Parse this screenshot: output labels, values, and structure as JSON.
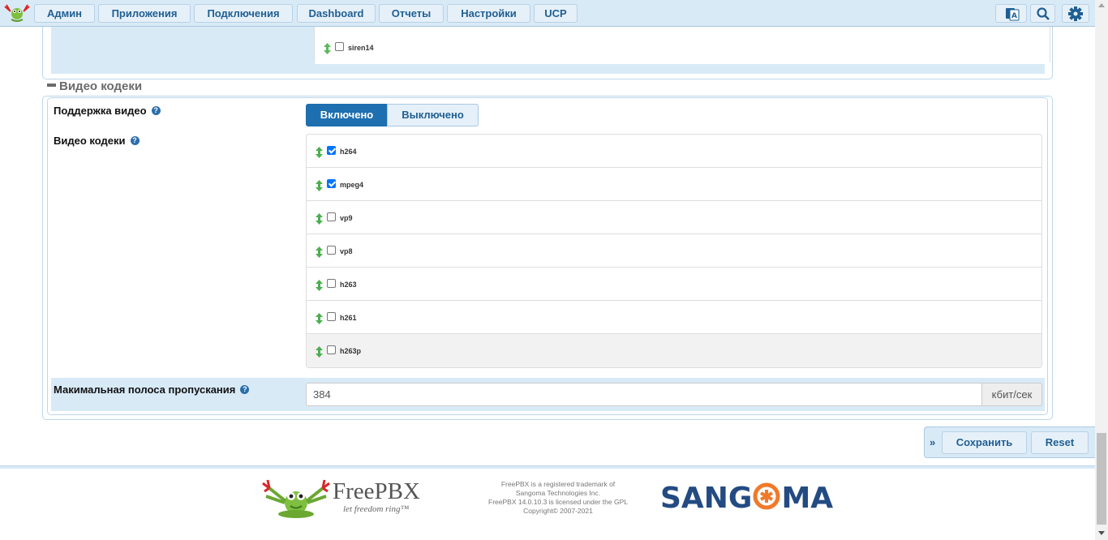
{
  "nav": {
    "items": [
      {
        "label": "Админ"
      },
      {
        "label": "Приложения"
      },
      {
        "label": "Подключения"
      },
      {
        "label": "Dashboard"
      },
      {
        "label": "Отчеты"
      },
      {
        "label": "Настройки"
      },
      {
        "label": "UCP"
      }
    ],
    "icons": [
      "language-icon",
      "search-icon",
      "gear-icon"
    ]
  },
  "prev_section": {
    "codec": {
      "name": "siren14",
      "checked": false
    }
  },
  "video_section": {
    "title": "Видео кодеки",
    "support_label": "Поддержка видео",
    "toggle": {
      "on_label": "Включено",
      "off_label": "Выключено",
      "selected": "Включено"
    },
    "codecs_label": "Видео кодеки",
    "codecs": [
      {
        "name": "h264",
        "checked": true
      },
      {
        "name": "mpeg4",
        "checked": true
      },
      {
        "name": "vp9",
        "checked": false
      },
      {
        "name": "vp8",
        "checked": false
      },
      {
        "name": "h263",
        "checked": false
      },
      {
        "name": "h261",
        "checked": false
      },
      {
        "name": "h263p",
        "checked": false
      }
    ],
    "bandwidth_label": "Макимальная полоса пропускания",
    "bandwidth_value": "384",
    "bandwidth_unit": "кбит/сек"
  },
  "actions": {
    "save_label": "Сохранить",
    "reset_label": "Reset"
  },
  "footer": {
    "freepbx_name": "FreePBX",
    "freepbx_tagline": "let freedom ring™",
    "legal_lines": [
      "FreePBX is a registered trademark of",
      "Sangoma Technologies Inc.",
      "FreePBX 14.0.10.3 is licensed under the GPL",
      "Copyright© 2007-2021"
    ],
    "sangoma_left": "SANG",
    "sangoma_right": "MA"
  },
  "colors": {
    "accent": "#1d6fb0",
    "panel": "#d9eaf7",
    "checkbox": "#0075ff",
    "arrow": "#4caf50"
  }
}
